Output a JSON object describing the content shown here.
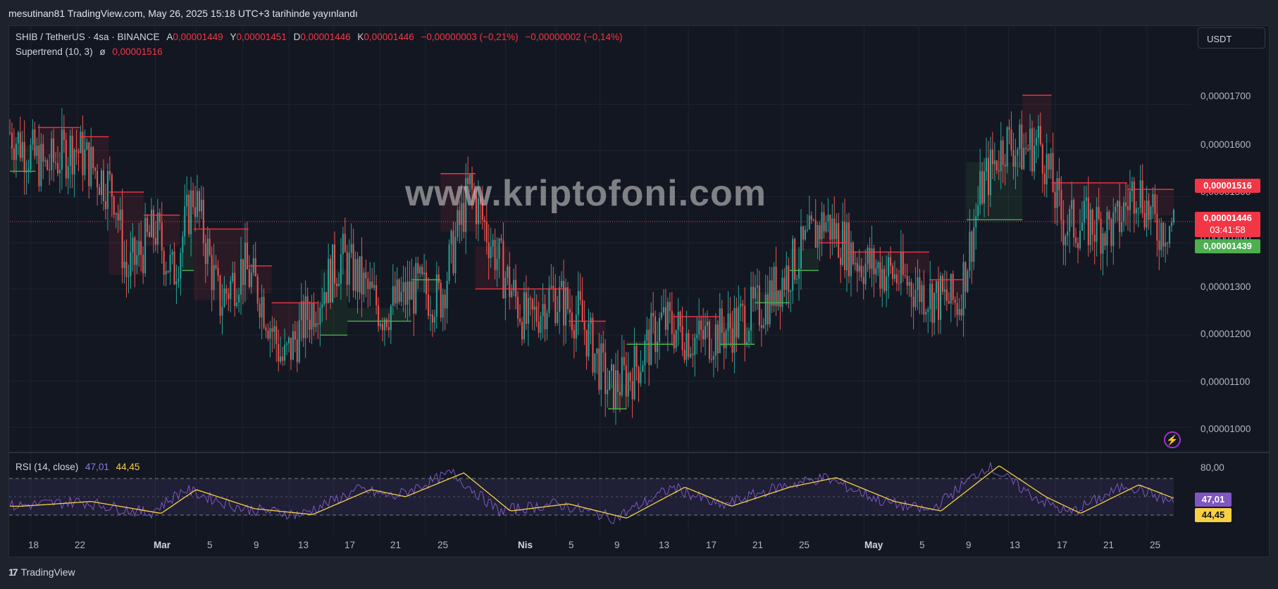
{
  "published": "mesutinan81 TradingView.com, May 26, 2025 15:18 UTC+3 tarihinde yayınlandı",
  "legend": {
    "symbol": "SHIB / TetherUS · 4sa · BINANCE",
    "o_label": "A",
    "o": "0,00001449",
    "h_label": "Y",
    "h": "0,00001451",
    "l_label": "D",
    "l": "0,00001446",
    "c_label": "K",
    "c": "0,00001446",
    "change": "−0,00000003 (−0,21%)",
    "change2": "−0,00000002 (−0,14%)",
    "supertrend_label": "Supertrend (10, 3)",
    "supertrend_glyph": "ø",
    "supertrend_value": "0,00001516",
    "rsi_label": "RSI (14, close)",
    "rsi_value": "47,01",
    "rsi_ma_value": "44,45"
  },
  "currency_button": "USDT",
  "price_axis": [
    "0,00001700",
    "0,00001600",
    "0,00001500",
    "0,00001400",
    "0,00001300",
    "0,00001200",
    "0,00001100",
    "0,00001000"
  ],
  "rsi_axis": [
    "80,00"
  ],
  "badges": {
    "supertrend": "0,00001516",
    "last_price": "0,00001446",
    "countdown": "03:41:58",
    "green": "0,00001439",
    "rsi": "47,01",
    "rsi_ma": "44,45"
  },
  "x_axis": [
    "18",
    "22",
    "Mar",
    "5",
    "9",
    "13",
    "17",
    "21",
    "25",
    "Nis",
    "5",
    "9",
    "13",
    "17",
    "21",
    "25",
    "May",
    "5",
    "9",
    "13",
    "17",
    "21",
    "25"
  ],
  "watermark": "www.kriptofoni.com",
  "footer": "TradingView",
  "colors": {
    "up": "#26a69a",
    "down": "#ef5350",
    "st_up": "#4caf50",
    "st_down": "#f23645",
    "rsi": "#7e57c2",
    "rsi_ma": "#f7d044",
    "bg": "#131722"
  },
  "chart_data": {
    "type": "candlestick",
    "symbol": "SHIB / TetherUS",
    "interval": "4sa",
    "ylim": [
      9.5e-06,
      1.78e-05
    ],
    "ohlc_anchors": [
      {
        "x": 0.0,
        "y": 1.64e-05
      },
      {
        "x": 0.03,
        "y": 1.56e-05
      },
      {
        "x": 0.055,
        "y": 1.61e-05
      },
      {
        "x": 0.09,
        "y": 1.51e-05
      },
      {
        "x": 0.1,
        "y": 1.33e-05
      },
      {
        "x": 0.125,
        "y": 1.43e-05
      },
      {
        "x": 0.14,
        "y": 1.33e-05
      },
      {
        "x": 0.158,
        "y": 1.51e-05
      },
      {
        "x": 0.18,
        "y": 1.27e-05
      },
      {
        "x": 0.2,
        "y": 1.35e-05
      },
      {
        "x": 0.215,
        "y": 1.29e-05
      },
      {
        "x": 0.235,
        "y": 1.14e-05
      },
      {
        "x": 0.255,
        "y": 1.24e-05
      },
      {
        "x": 0.285,
        "y": 1.37e-05
      },
      {
        "x": 0.32,
        "y": 1.25e-05
      },
      {
        "x": 0.35,
        "y": 1.3e-05
      },
      {
        "x": 0.37,
        "y": 1.28e-05
      },
      {
        "x": 0.395,
        "y": 1.52e-05
      },
      {
        "x": 0.42,
        "y": 1.36e-05
      },
      {
        "x": 0.445,
        "y": 1.22e-05
      },
      {
        "x": 0.465,
        "y": 1.29e-05
      },
      {
        "x": 0.49,
        "y": 1.24e-05
      },
      {
        "x": 0.515,
        "y": 1.08e-05
      },
      {
        "x": 0.535,
        "y": 1.12e-05
      },
      {
        "x": 0.56,
        "y": 1.23e-05
      },
      {
        "x": 0.59,
        "y": 1.19e-05
      },
      {
        "x": 0.615,
        "y": 1.21e-05
      },
      {
        "x": 0.645,
        "y": 1.26e-05
      },
      {
        "x": 0.675,
        "y": 1.36e-05
      },
      {
        "x": 0.7,
        "y": 1.45e-05
      },
      {
        "x": 0.73,
        "y": 1.36e-05
      },
      {
        "x": 0.76,
        "y": 1.33e-05
      },
      {
        "x": 0.795,
        "y": 1.28e-05
      },
      {
        "x": 0.815,
        "y": 1.27e-05
      },
      {
        "x": 0.835,
        "y": 1.52e-05
      },
      {
        "x": 0.855,
        "y": 1.62e-05
      },
      {
        "x": 0.87,
        "y": 1.6e-05
      },
      {
        "x": 0.885,
        "y": 1.62e-05
      },
      {
        "x": 0.905,
        "y": 1.44e-05
      },
      {
        "x": 0.93,
        "y": 1.44e-05
      },
      {
        "x": 0.95,
        "y": 1.43e-05
      },
      {
        "x": 0.968,
        "y": 1.53e-05
      },
      {
        "x": 0.985,
        "y": 1.43e-05
      },
      {
        "x": 1.0,
        "y": 1.446e-05
      }
    ],
    "supertrend": [
      {
        "from": 0.0,
        "to": 0.022,
        "value": 1.555e-05,
        "trend": "up"
      },
      {
        "from": 0.024,
        "to": 0.06,
        "value": 1.65e-05,
        "trend": "down"
      },
      {
        "from": 0.06,
        "to": 0.085,
        "value": 1.63e-05,
        "trend": "down"
      },
      {
        "from": 0.085,
        "to": 0.115,
        "value": 1.51e-05,
        "trend": "down"
      },
      {
        "from": 0.115,
        "to": 0.146,
        "value": 1.46e-05,
        "trend": "down"
      },
      {
        "from": 0.148,
        "to": 0.158,
        "value": 1.34e-05,
        "trend": "up"
      },
      {
        "from": 0.158,
        "to": 0.205,
        "value": 1.43e-05,
        "trend": "down"
      },
      {
        "from": 0.205,
        "to": 0.225,
        "value": 1.35e-05,
        "trend": "down"
      },
      {
        "from": 0.225,
        "to": 0.265,
        "value": 1.27e-05,
        "trend": "down"
      },
      {
        "from": 0.267,
        "to": 0.29,
        "value": 1.2e-05,
        "trend": "up"
      },
      {
        "from": 0.29,
        "to": 0.345,
        "value": 1.23e-05,
        "trend": "up"
      },
      {
        "from": 0.345,
        "to": 0.37,
        "value": 1.32e-05,
        "trend": "up"
      },
      {
        "from": 0.37,
        "to": 0.4,
        "value": 1.55e-05,
        "trend": "down"
      },
      {
        "from": 0.4,
        "to": 0.43,
        "value": 1.3e-05,
        "trend": "down"
      },
      {
        "from": 0.43,
        "to": 0.48,
        "value": 1.3e-05,
        "trend": "down"
      },
      {
        "from": 0.48,
        "to": 0.512,
        "value": 1.23e-05,
        "trend": "down"
      },
      {
        "from": 0.514,
        "to": 0.53,
        "value": 1.04e-05,
        "trend": "up"
      },
      {
        "from": 0.53,
        "to": 0.57,
        "value": 1.18e-05,
        "trend": "up"
      },
      {
        "from": 0.57,
        "to": 0.61,
        "value": 1.24e-05,
        "trend": "down"
      },
      {
        "from": 0.61,
        "to": 0.64,
        "value": 1.18e-05,
        "trend": "up"
      },
      {
        "from": 0.64,
        "to": 0.67,
        "value": 1.27e-05,
        "trend": "up"
      },
      {
        "from": 0.67,
        "to": 0.695,
        "value": 1.34e-05,
        "trend": "up"
      },
      {
        "from": 0.695,
        "to": 0.72,
        "value": 1.4e-05,
        "trend": "down"
      },
      {
        "from": 0.72,
        "to": 0.79,
        "value": 1.38e-05,
        "trend": "down"
      },
      {
        "from": 0.79,
        "to": 0.82,
        "value": 1.32e-05,
        "trend": "down"
      },
      {
        "from": 0.822,
        "to": 0.87,
        "value": 1.45e-05,
        "trend": "up"
      },
      {
        "from": 0.87,
        "to": 0.895,
        "value": 1.72e-05,
        "trend": "down"
      },
      {
        "from": 0.895,
        "to": 0.96,
        "value": 1.53e-05,
        "trend": "down"
      },
      {
        "from": 0.96,
        "to": 1.0,
        "value": 1.516e-05,
        "trend": "down"
      }
    ],
    "last_price": 1.446e-05,
    "supertrend_value": 1.516e-05,
    "rsi": {
      "period": 14,
      "value": 47.01,
      "ma_value": 44.45,
      "levels": [
        70,
        50,
        30
      ],
      "ylim": [
        20,
        85
      ],
      "anchors": [
        {
          "x": 0.0,
          "y": 44
        },
        {
          "x": 0.06,
          "y": 48
        },
        {
          "x": 0.12,
          "y": 38
        },
        {
          "x": 0.15,
          "y": 58
        },
        {
          "x": 0.2,
          "y": 42
        },
        {
          "x": 0.25,
          "y": 37
        },
        {
          "x": 0.3,
          "y": 58
        },
        {
          "x": 0.33,
          "y": 52
        },
        {
          "x": 0.38,
          "y": 72
        },
        {
          "x": 0.42,
          "y": 40
        },
        {
          "x": 0.47,
          "y": 46
        },
        {
          "x": 0.52,
          "y": 34
        },
        {
          "x": 0.57,
          "y": 60
        },
        {
          "x": 0.61,
          "y": 44
        },
        {
          "x": 0.66,
          "y": 60
        },
        {
          "x": 0.7,
          "y": 68
        },
        {
          "x": 0.75,
          "y": 48
        },
        {
          "x": 0.79,
          "y": 40
        },
        {
          "x": 0.84,
          "y": 78
        },
        {
          "x": 0.88,
          "y": 52
        },
        {
          "x": 0.91,
          "y": 38
        },
        {
          "x": 0.96,
          "y": 62
        },
        {
          "x": 1.0,
          "y": 47
        }
      ]
    }
  }
}
